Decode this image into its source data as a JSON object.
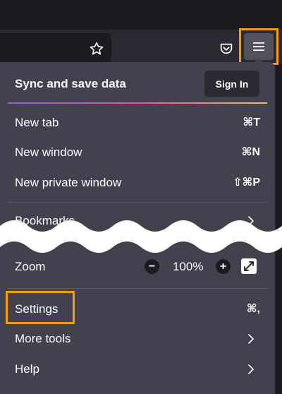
{
  "toolbar": {
    "bookmark_star_icon": "star-outline-icon",
    "pocket_icon": "pocket-icon",
    "app_menu_icon": "hamburger-menu-icon",
    "highlight_color": "#f39c12"
  },
  "panel": {
    "sync_title": "Sync and save data",
    "sign_in_label": "Sign In",
    "items": [
      {
        "label": "New tab",
        "shortcut": "⌘T"
      },
      {
        "label": "New window",
        "shortcut": "⌘N"
      },
      {
        "label": "New private window",
        "shortcut": "⇧⌘P"
      },
      {
        "label": "Bookmarks"
      },
      {
        "label": "Zoom"
      },
      {
        "label": "Settings",
        "shortcut": "⌘,"
      },
      {
        "label": "More tools"
      },
      {
        "label": "Help"
      }
    ],
    "zoom": {
      "minus": "−",
      "value": "100%",
      "plus": "+"
    }
  },
  "colors": {
    "panel_bg": "#42414d",
    "toolbar_bg": "#2b2a33",
    "accent_gradient": [
      "#9059ff",
      "#ff4aa2",
      "#ffbd4f"
    ]
  }
}
